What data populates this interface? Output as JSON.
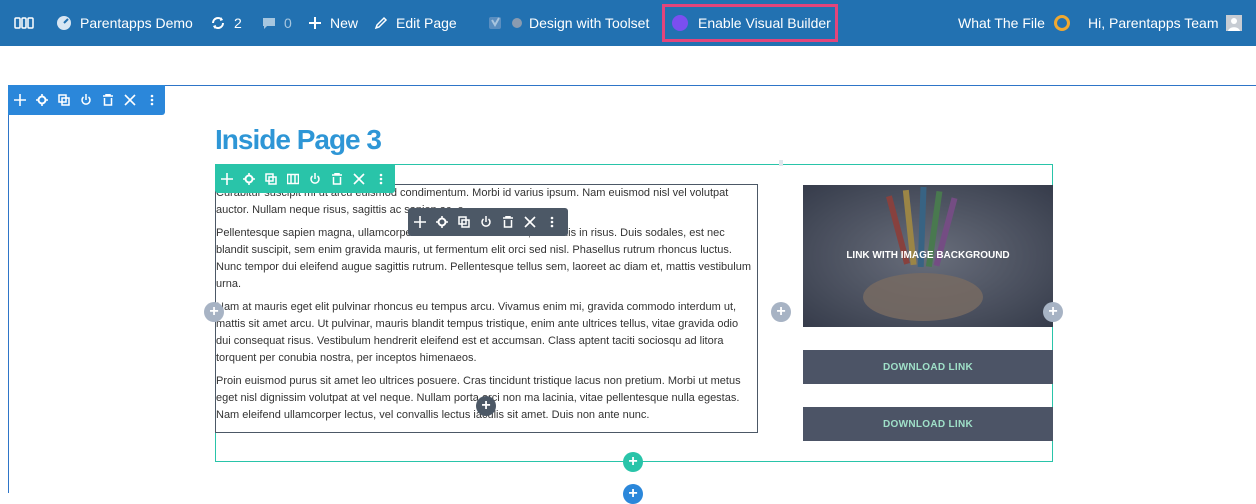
{
  "admin_bar": {
    "site_name": "Parentapps Demo",
    "updates_count": "2",
    "comments_count": "0",
    "new_label": "New",
    "edit_page_label": "Edit Page",
    "toolset_label": "Design with Toolset",
    "visual_builder_label": "Enable Visual Builder",
    "what_the_file_label": "What The File",
    "greeting": "Hi, Parentapps Team"
  },
  "page": {
    "title": "Inside Page 3"
  },
  "text_module": {
    "paragraphs": [
      "Curabitur suscipit mi ut arcu euismod condimentum. Morbi id varius ipsum. Nam euismod nisl vel volutpat auctor. Nullam neque risus, sagittis ac sapien ac, e",
      "Pellentesque sapien magna, ullamcorper eu fermentum sit amet, convallis in risus. Duis sodales, est nec blandit suscipit, sem enim gravida mauris, ut fermentum elit orci sed nisl. Phasellus rutrum rhoncus luctus. Nunc tempor dui eleifend augue sagittis rutrum. Pellentesque tellus sem, laoreet ac diam et, mattis vestibulum urna.",
      "Nam at mauris eget elit pulvinar rhoncus eu tempus arcu. Vivamus enim mi, gravida commodo interdum ut, mattis sit amet arcu. Ut pulvinar, mauris blandit tempus tristique, enim ante ultrices tellus, vitae gravida odio dui consequat risus. Vestibulum hendrerit eleifend est et accumsan. Class aptent taciti sociosqu ad litora torquent per conubia nostra, per inceptos himenaeos.",
      "Proin euismod purus sit amet leo ultrices posuere. Cras tincidunt tristique lacus non pretium. Morbi ut metus eget nisl dignissim volutpat at vel neque. Nullam porta orci non ma lacinia, vitae pellentesque nulla egestas. Nam eleifend ullamcorper lectus, vel convallis lectus iaculis sit amet. Duis non ante nunc."
    ]
  },
  "image_link": {
    "label": "LINK WITH IMAGE BACKGROUND"
  },
  "download_links": [
    {
      "label": "DOWNLOAD LINK"
    },
    {
      "label": "DOWNLOAD LINK"
    }
  ],
  "icons": {
    "section_toolbar": [
      "move-icon",
      "settings-icon",
      "duplicate-icon",
      "power-icon",
      "delete-icon",
      "close-icon",
      "more-icon"
    ],
    "row_toolbar": [
      "move-icon",
      "settings-icon",
      "duplicate-icon",
      "columns-icon",
      "power-icon",
      "delete-icon",
      "close-icon",
      "more-icon"
    ],
    "module_toolbar": [
      "move-icon",
      "settings-icon",
      "duplicate-icon",
      "power-icon",
      "delete-icon",
      "close-icon",
      "more-icon"
    ]
  },
  "colors": {
    "admin_bar": "#2271b1",
    "section_accent": "#2b87da",
    "row_accent": "#29c4a9",
    "module_accent": "#4c5866",
    "title": "#2e96d6",
    "highlight_border": "#e3457b",
    "download_button_bg": "#4c5466",
    "download_button_text": "#9fe0c8"
  },
  "add_buttons": {
    "symbol": "+"
  }
}
